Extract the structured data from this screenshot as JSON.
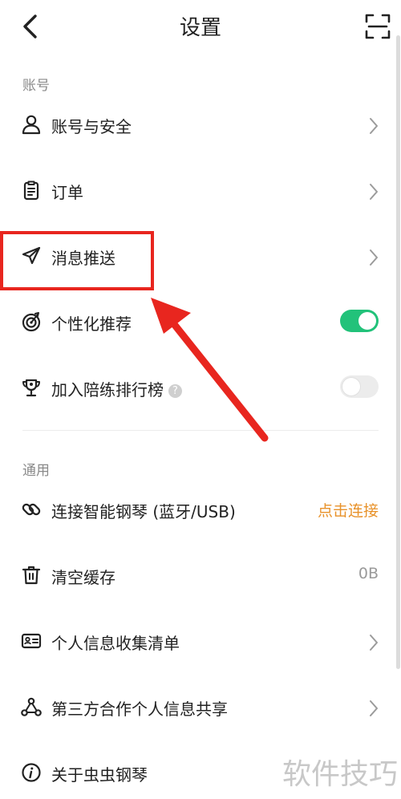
{
  "header": {
    "title": "设置",
    "back_icon": "chevron-left-icon",
    "scan_icon": "scan-icon"
  },
  "sections": {
    "account": "账号",
    "general": "通用"
  },
  "account_items": [
    {
      "label": "账号与安全",
      "icon": "user-icon",
      "trailing": "chevron"
    },
    {
      "label": "订单",
      "icon": "clipboard-icon",
      "trailing": "chevron"
    },
    {
      "label": "消息推送",
      "icon": "send-icon",
      "trailing": "chevron"
    },
    {
      "label": "个性化推荐",
      "icon": "target-icon",
      "trailing": "toggle",
      "enabled": true
    },
    {
      "label": "加入陪练排行榜",
      "icon": "trophy-icon",
      "trailing": "toggle",
      "enabled": false,
      "help": "?"
    }
  ],
  "general_items": [
    {
      "label": "连接智能钢琴 (蓝牙/USB)",
      "icon": "link-icon",
      "value": "点击连接"
    },
    {
      "label": "清空缓存",
      "icon": "trash-icon",
      "value": "0B"
    },
    {
      "label": "个人信息收集清单",
      "icon": "id-card-icon",
      "trailing": "chevron"
    },
    {
      "label": "第三方合作个人信息共享",
      "icon": "share-icon",
      "trailing": "chevron"
    },
    {
      "label": "关于虫虫钢琴",
      "icon": "info-icon"
    }
  ],
  "watermark": "软件技巧",
  "colors": {
    "toggle_on": "#22c27a",
    "toggle_off": "#ececec",
    "link": "#e8922a",
    "annotation": "#e8261f",
    "section": "#8a8a8a"
  }
}
